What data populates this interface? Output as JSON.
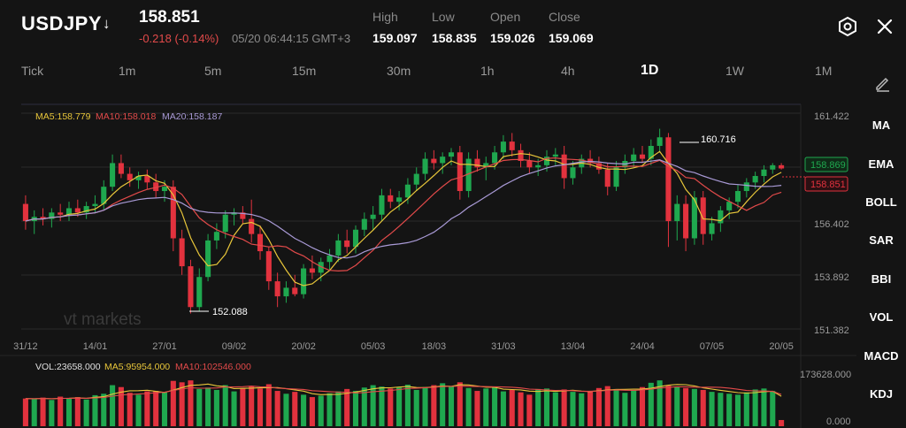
{
  "header": {
    "symbol": "USDJPY",
    "symbol_arrow": "↓",
    "price": "158.851",
    "change": "-0.218 (-0.14%)",
    "timestamp": "05/20 06:44:15 GMT+3",
    "ohlc": [
      {
        "label": "High",
        "value": "159.097"
      },
      {
        "label": "Low",
        "value": "158.835"
      },
      {
        "label": "Open",
        "value": "159.026"
      },
      {
        "label": "Close",
        "value": "159.069"
      }
    ]
  },
  "timeframes": [
    "Tick",
    "1m",
    "5m",
    "15m",
    "30m",
    "1h",
    "4h",
    "1D",
    "1W",
    "1M"
  ],
  "active_timeframe": "1D",
  "indicators": [
    "MA",
    "EMA",
    "BOLL",
    "SAR",
    "BBI",
    "VOL",
    "MACD",
    "KDJ"
  ],
  "main_chart": {
    "ma_legend": [
      {
        "text": "MA5:158.779",
        "color": "#e8c63a"
      },
      {
        "text": "MA10:158.018",
        "color": "#e24a4a"
      },
      {
        "text": "MA20:158.187",
        "color": "#a99ad6"
      }
    ],
    "y_ticks": [
      "161.422",
      "156.402",
      "153.892",
      "151.382"
    ],
    "current_price_tag": "158.869",
    "last_price_tag": "158.851",
    "max_marker": "160.716",
    "min_marker": "152.088",
    "watermark": "vt markets",
    "x_ticks": [
      "31/12",
      "14/01",
      "27/01",
      "09/02",
      "20/02",
      "05/03",
      "18/03",
      "31/03",
      "13/04",
      "24/04",
      "07/05",
      "20/05"
    ]
  },
  "volume_chart": {
    "legend": [
      {
        "text": "VOL:23658.000",
        "color": "#e0e0e0"
      },
      {
        "text": "MA5:95954.000",
        "color": "#e8c63a"
      },
      {
        "text": "MA10:102546.000",
        "color": "#e24a4a"
      }
    ],
    "y_ticks": [
      "173628.000",
      "0.000"
    ]
  },
  "colors": {
    "up": "#1fa84f",
    "down": "#e2323e",
    "ma5": "#e8c63a",
    "ma10": "#e24a4a",
    "ma20": "#a99ad6",
    "grid": "#2a2a2a"
  },
  "chart_data": {
    "type": "candlestick",
    "ylim": [
      151.382,
      161.422
    ],
    "candles": [
      {
        "o": 157.2,
        "h": 157.6,
        "l": 156.0,
        "c": 156.4
      },
      {
        "o": 156.4,
        "h": 156.9,
        "l": 155.8,
        "c": 156.6
      },
      {
        "o": 156.6,
        "h": 157.0,
        "l": 156.2,
        "c": 156.5
      },
      {
        "o": 156.5,
        "h": 157.0,
        "l": 156.1,
        "c": 156.8
      },
      {
        "o": 156.8,
        "h": 157.2,
        "l": 156.4,
        "c": 156.7
      },
      {
        "o": 156.7,
        "h": 157.3,
        "l": 156.4,
        "c": 157.0
      },
      {
        "o": 157.0,
        "h": 157.4,
        "l": 156.6,
        "c": 156.8
      },
      {
        "o": 156.8,
        "h": 157.3,
        "l": 156.5,
        "c": 157.1
      },
      {
        "o": 157.1,
        "h": 157.6,
        "l": 156.8,
        "c": 157.2
      },
      {
        "o": 157.2,
        "h": 158.3,
        "l": 156.9,
        "c": 158.0
      },
      {
        "o": 158.0,
        "h": 159.5,
        "l": 157.8,
        "c": 159.1
      },
      {
        "o": 159.1,
        "h": 159.5,
        "l": 158.4,
        "c": 158.6
      },
      {
        "o": 158.6,
        "h": 158.9,
        "l": 158.0,
        "c": 158.3
      },
      {
        "o": 158.3,
        "h": 158.7,
        "l": 157.9,
        "c": 158.5
      },
      {
        "o": 158.5,
        "h": 158.8,
        "l": 157.9,
        "c": 158.2
      },
      {
        "o": 158.2,
        "h": 158.6,
        "l": 157.5,
        "c": 157.8
      },
      {
        "o": 157.8,
        "h": 158.3,
        "l": 157.3,
        "c": 158.0
      },
      {
        "o": 158.0,
        "h": 158.3,
        "l": 155.0,
        "c": 155.6
      },
      {
        "o": 155.6,
        "h": 156.0,
        "l": 153.9,
        "c": 154.3
      },
      {
        "o": 154.3,
        "h": 154.6,
        "l": 152.1,
        "c": 152.4
      },
      {
        "o": 152.4,
        "h": 154.2,
        "l": 152.2,
        "c": 153.8
      },
      {
        "o": 153.8,
        "h": 155.8,
        "l": 153.6,
        "c": 155.5
      },
      {
        "o": 155.5,
        "h": 156.3,
        "l": 155.1,
        "c": 155.9
      },
      {
        "o": 155.9,
        "h": 156.9,
        "l": 155.6,
        "c": 156.7
      },
      {
        "o": 156.7,
        "h": 157.0,
        "l": 156.2,
        "c": 156.8
      },
      {
        "o": 156.8,
        "h": 157.1,
        "l": 156.3,
        "c": 156.5
      },
      {
        "o": 156.5,
        "h": 157.4,
        "l": 155.4,
        "c": 155.8
      },
      {
        "o": 155.8,
        "h": 156.2,
        "l": 154.6,
        "c": 155.0
      },
      {
        "o": 155.0,
        "h": 155.2,
        "l": 153.2,
        "c": 153.6
      },
      {
        "o": 153.6,
        "h": 154.0,
        "l": 152.4,
        "c": 152.9
      },
      {
        "o": 152.9,
        "h": 153.6,
        "l": 152.6,
        "c": 153.3
      },
      {
        "o": 153.3,
        "h": 153.9,
        "l": 152.9,
        "c": 153.0
      },
      {
        "o": 153.0,
        "h": 154.4,
        "l": 152.8,
        "c": 154.2
      },
      {
        "o": 154.2,
        "h": 154.8,
        "l": 153.7,
        "c": 154.0
      },
      {
        "o": 154.0,
        "h": 154.7,
        "l": 153.6,
        "c": 154.5
      },
      {
        "o": 154.5,
        "h": 155.1,
        "l": 154.1,
        "c": 154.8
      },
      {
        "o": 154.8,
        "h": 155.8,
        "l": 154.5,
        "c": 155.5
      },
      {
        "o": 155.5,
        "h": 156.0,
        "l": 154.9,
        "c": 155.2
      },
      {
        "o": 155.2,
        "h": 156.2,
        "l": 154.9,
        "c": 156.0
      },
      {
        "o": 156.0,
        "h": 156.8,
        "l": 155.7,
        "c": 156.5
      },
      {
        "o": 156.5,
        "h": 157.1,
        "l": 156.0,
        "c": 156.7
      },
      {
        "o": 156.7,
        "h": 157.9,
        "l": 156.4,
        "c": 157.6
      },
      {
        "o": 157.6,
        "h": 157.9,
        "l": 157.0,
        "c": 157.3
      },
      {
        "o": 157.3,
        "h": 157.8,
        "l": 156.9,
        "c": 157.5
      },
      {
        "o": 157.5,
        "h": 158.4,
        "l": 157.2,
        "c": 158.1
      },
      {
        "o": 158.1,
        "h": 158.9,
        "l": 157.8,
        "c": 158.6
      },
      {
        "o": 158.6,
        "h": 159.6,
        "l": 158.3,
        "c": 159.3
      },
      {
        "o": 159.3,
        "h": 159.7,
        "l": 158.8,
        "c": 159.1
      },
      {
        "o": 159.1,
        "h": 159.6,
        "l": 158.6,
        "c": 159.4
      },
      {
        "o": 159.4,
        "h": 159.8,
        "l": 159.0,
        "c": 159.6
      },
      {
        "o": 159.6,
        "h": 159.9,
        "l": 157.4,
        "c": 157.8
      },
      {
        "o": 157.8,
        "h": 159.6,
        "l": 157.5,
        "c": 159.3
      },
      {
        "o": 159.3,
        "h": 159.7,
        "l": 158.7,
        "c": 158.9
      },
      {
        "o": 158.9,
        "h": 159.4,
        "l": 158.3,
        "c": 159.1
      },
      {
        "o": 159.1,
        "h": 159.9,
        "l": 158.8,
        "c": 159.6
      },
      {
        "o": 159.6,
        "h": 160.4,
        "l": 159.3,
        "c": 160.1
      },
      {
        "o": 160.1,
        "h": 160.5,
        "l": 159.4,
        "c": 159.7
      },
      {
        "o": 159.7,
        "h": 160.0,
        "l": 158.9,
        "c": 159.2
      },
      {
        "o": 159.2,
        "h": 159.6,
        "l": 158.6,
        "c": 158.9
      },
      {
        "o": 158.9,
        "h": 159.3,
        "l": 158.5,
        "c": 159.0
      },
      {
        "o": 159.0,
        "h": 159.7,
        "l": 158.7,
        "c": 159.4
      },
      {
        "o": 159.4,
        "h": 159.8,
        "l": 159.0,
        "c": 159.5
      },
      {
        "o": 159.5,
        "h": 159.9,
        "l": 157.9,
        "c": 158.4
      },
      {
        "o": 158.4,
        "h": 159.2,
        "l": 158.1,
        "c": 158.9
      },
      {
        "o": 158.9,
        "h": 159.5,
        "l": 158.6,
        "c": 159.3
      },
      {
        "o": 159.3,
        "h": 159.7,
        "l": 158.9,
        "c": 159.1
      },
      {
        "o": 159.1,
        "h": 159.4,
        "l": 158.6,
        "c": 158.8
      },
      {
        "o": 158.8,
        "h": 159.1,
        "l": 157.6,
        "c": 158.0
      },
      {
        "o": 158.0,
        "h": 159.2,
        "l": 157.8,
        "c": 158.9
      },
      {
        "o": 158.9,
        "h": 159.5,
        "l": 158.6,
        "c": 159.2
      },
      {
        "o": 159.2,
        "h": 159.8,
        "l": 158.9,
        "c": 159.5
      },
      {
        "o": 159.5,
        "h": 159.9,
        "l": 159.1,
        "c": 159.3
      },
      {
        "o": 159.3,
        "h": 160.2,
        "l": 159.0,
        "c": 159.9
      },
      {
        "o": 159.9,
        "h": 160.7,
        "l": 159.6,
        "c": 160.3
      },
      {
        "o": 160.3,
        "h": 160.5,
        "l": 155.2,
        "c": 156.4
      },
      {
        "o": 156.4,
        "h": 157.6,
        "l": 155.5,
        "c": 157.2
      },
      {
        "o": 157.2,
        "h": 157.6,
        "l": 155.0,
        "c": 155.6
      },
      {
        "o": 155.6,
        "h": 157.8,
        "l": 155.3,
        "c": 157.5
      },
      {
        "o": 157.5,
        "h": 157.8,
        "l": 155.3,
        "c": 155.8
      },
      {
        "o": 155.8,
        "h": 156.6,
        "l": 155.5,
        "c": 156.3
      },
      {
        "o": 156.3,
        "h": 157.1,
        "l": 155.9,
        "c": 156.9
      },
      {
        "o": 156.9,
        "h": 157.5,
        "l": 156.5,
        "c": 157.3
      },
      {
        "o": 157.3,
        "h": 158.1,
        "l": 157.0,
        "c": 157.8
      },
      {
        "o": 157.8,
        "h": 158.4,
        "l": 157.5,
        "c": 158.2
      },
      {
        "o": 158.2,
        "h": 158.7,
        "l": 157.9,
        "c": 158.5
      },
      {
        "o": 158.5,
        "h": 159.0,
        "l": 158.2,
        "c": 158.8
      },
      {
        "o": 158.8,
        "h": 159.1,
        "l": 158.6,
        "c": 159.0
      },
      {
        "o": 159.0,
        "h": 159.1,
        "l": 158.8,
        "c": 158.85
      }
    ],
    "volume": [
      0.58,
      0.57,
      0.6,
      0.55,
      0.62,
      0.59,
      0.61,
      0.56,
      0.65,
      0.68,
      0.86,
      0.82,
      0.7,
      0.66,
      0.73,
      0.74,
      0.71,
      0.95,
      0.92,
      0.96,
      0.78,
      0.81,
      0.76,
      0.86,
      0.73,
      0.8,
      0.84,
      0.79,
      0.88,
      0.74,
      0.68,
      0.72,
      0.66,
      0.61,
      0.64,
      0.69,
      0.73,
      0.78,
      0.74,
      0.81,
      0.86,
      0.83,
      0.79,
      0.81,
      0.87,
      0.76,
      0.82,
      0.86,
      0.9,
      0.84,
      0.92,
      0.8,
      0.74,
      0.79,
      0.82,
      0.73,
      0.76,
      0.71,
      0.66,
      0.78,
      0.79,
      0.71,
      0.77,
      0.72,
      0.69,
      0.74,
      0.8,
      0.84,
      0.78,
      0.7,
      0.76,
      0.82,
      0.91,
      0.96,
      0.85,
      0.83,
      0.8,
      0.78,
      0.76,
      0.72,
      0.7,
      0.68,
      0.66,
      0.71,
      0.77,
      0.79,
      0.74,
      0.13
    ],
    "volume_ylim": [
      0,
      173628
    ]
  }
}
